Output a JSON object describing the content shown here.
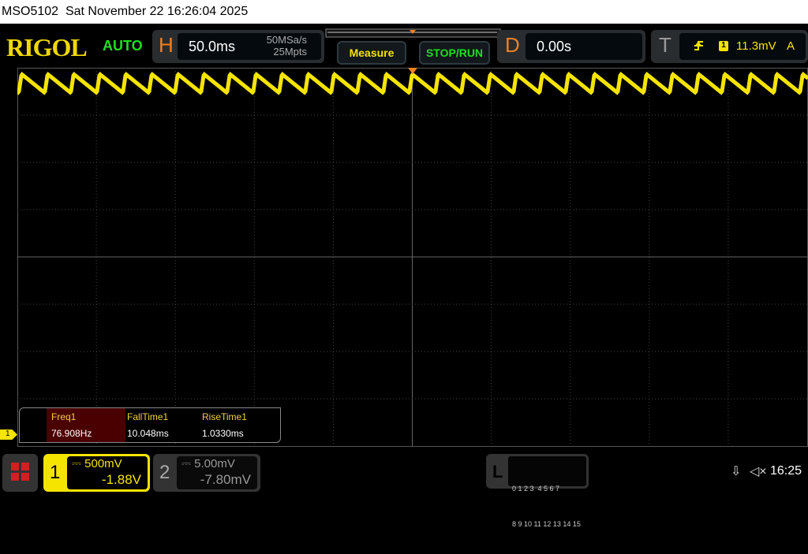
{
  "titlebar": {
    "model": "MSO5102",
    "datetime": "Sat November 22 16:26:04 2025"
  },
  "header": {
    "logo": "RIGOL",
    "mode": "AUTO",
    "horizontal": {
      "letter": "H",
      "timebase": "50.0ms",
      "sample_rate": "50MSa/s",
      "memory_depth": "25Mpts"
    },
    "measure_button": "Measure",
    "stop_run_button": "STOP/RUN",
    "delay": {
      "letter": "D",
      "value": "0.00s"
    },
    "trigger": {
      "letter": "T",
      "source": "1",
      "level": "11.3mV",
      "sweep": "A",
      "slope_icon": "rising-edge-icon"
    }
  },
  "measurements": [
    {
      "label": "Freq1",
      "value": "76.908Hz",
      "highlighted": true
    },
    {
      "label": "FallTime1",
      "value": "10.048ms"
    },
    {
      "label": "RiseTime1",
      "value": "1.0330ms"
    }
  ],
  "channel1_marker": "1",
  "channels": [
    {
      "number": "1",
      "scale": "500mV",
      "offset": "-1.88V",
      "active": true,
      "color": "#f5e400"
    },
    {
      "number": "2",
      "scale": "5.00mV",
      "offset": "-7.80mV",
      "active": false
    }
  ],
  "logic": {
    "letter": "L",
    "row1": "0 1 2 3  4 5 6 7",
    "row2": "8 9 10 11 12 13 14 15"
  },
  "status": {
    "usb_icon": "usb-icon",
    "sound_icon": "speaker-muted-icon",
    "time": "16:25"
  },
  "colors": {
    "ch1": "#f5e400",
    "accent": "#f08020",
    "green": "#22dd22"
  }
}
